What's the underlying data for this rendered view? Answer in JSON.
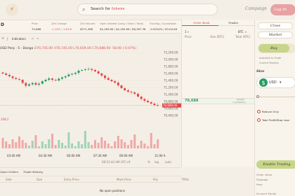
{
  "header": {
    "search_placeholder": "Search for",
    "search_accent": "tokens",
    "campaign_label": "Campaign",
    "login_label": "Log In"
  },
  "stats": {
    "pair_fragment": "D",
    "cols": [
      {
        "label": "Price",
        "value": "70,688",
        "tone": "normal"
      },
      {
        "label": "24h Change",
        "value": "-1,155 / -1.61%",
        "tone": "red"
      },
      {
        "label": "24h Volume",
        "value": "$571,386",
        "tone": "normal"
      },
      {
        "label": "Open Interest (Long / Short / Total)",
        "value": "$4,183.69 / $4,183.69 / $8,367.38",
        "tone": "normal"
      },
      {
        "label": "Funding / Countdown",
        "value": "-0.0024% / 00:04:48",
        "tone": "normal"
      }
    ]
  },
  "toolbar": {
    "indicators": "Indicators"
  },
  "chart_legend": {
    "pair": "USD Perp · 5 · Dango",
    "o": "70,745.00",
    "h": "70,745.00",
    "l": "70,659.00",
    "c": "70,688.00",
    "chg": "-58.00 (-0.07%)"
  },
  "chart_data": {
    "type": "candlestick",
    "y_ticks": [
      "72,200.00",
      "72,000.00",
      "71,800.00",
      "71,600.00",
      "71,400.00",
      "71,200.00",
      "71,000.00",
      "70,800.00",
      "70,600.00",
      "70,400.00"
    ],
    "x_ticks": [
      "03:00 AM",
      "04:30 AM",
      "06:00 AM",
      "07:30 AM",
      "09:00 AM",
      "11:00 A"
    ],
    "price_tag": "70,688.00",
    "volume_tag": "208.2",
    "close_series": [
      71600,
      71560,
      71520,
      71470,
      71440,
      71420,
      71330,
      71250,
      71290,
      71330,
      71280,
      71310,
      71380,
      71420,
      71460,
      71420,
      71400,
      71450,
      71490,
      71520,
      71570,
      71590,
      71620,
      71680,
      71700,
      71720,
      71730,
      71700,
      71660,
      71600,
      71540,
      71470,
      71420,
      71380,
      71340,
      71260,
      71180,
      71120,
      71080,
      71060,
      71020,
      70940,
      70870,
      70820,
      70780,
      70740,
      70700,
      70688
    ]
  },
  "chart_footer": {
    "time": "08:51:44 AM UTC+9",
    "pct": "%",
    "log": "log",
    "auto": "auto"
  },
  "positions": {
    "tabs": [
      "Open Orders",
      "Trade History"
    ],
    "headers": [
      "Side",
      "Size",
      "Entry Price",
      "Mark Price",
      "PnL",
      "TP/SL"
    ],
    "empty": "No open positions"
  },
  "orderbook": {
    "tabs": [
      "Order Book",
      "Trades"
    ],
    "step": "1",
    "unit": "BTC",
    "col_price": "Price",
    "col_size": "Size (BTC)",
    "col_total": "Total (BTC)",
    "mid_price": "70,688",
    "spread_label": "Spread",
    "spread_value": "1 (0.0014%)"
  },
  "panel": {
    "mode_cross": "Cross",
    "mode_market": "Market",
    "buy": "Buy",
    "sell": "Sell",
    "available": "Available to Trade",
    "current_pos": "Current Position",
    "size_label": "Size",
    "currency": "USD",
    "reduce_only": "Reduce Only",
    "tpsl": "Take Profit/Stop Loss",
    "enable_trading": "Enable Trading",
    "order_value": "Order Value",
    "slippage": "Slippage",
    "fees": "Fees",
    "account": "Account Equity"
  }
}
